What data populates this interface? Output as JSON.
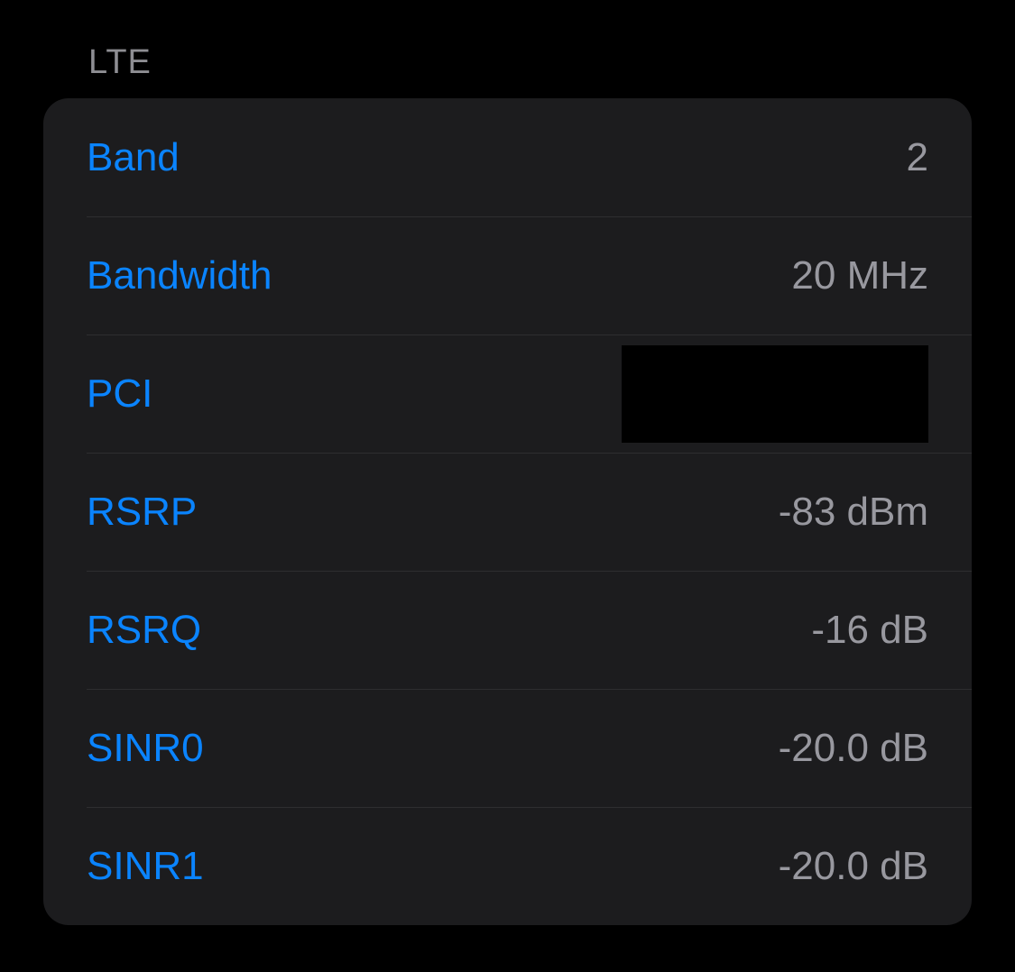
{
  "section": {
    "title": "LTE",
    "rows": [
      {
        "label": "Band",
        "value": "2",
        "redacted": false
      },
      {
        "label": "Bandwidth",
        "value": "20 MHz",
        "redacted": false
      },
      {
        "label": "PCI",
        "value": "",
        "redacted": true
      },
      {
        "label": "RSRP",
        "value": "-83 dBm",
        "redacted": false
      },
      {
        "label": "RSRQ",
        "value": "-16 dB",
        "redacted": false
      },
      {
        "label": "SINR0",
        "value": "-20.0 dB",
        "redacted": false
      },
      {
        "label": "SINR1",
        "value": "-20.0 dB",
        "redacted": false
      }
    ]
  },
  "colors": {
    "background": "#000000",
    "card": "#1c1c1e",
    "link": "#0a84ff",
    "value": "#98989f",
    "header": "#8e8e93",
    "separator": "#2e2e30"
  }
}
